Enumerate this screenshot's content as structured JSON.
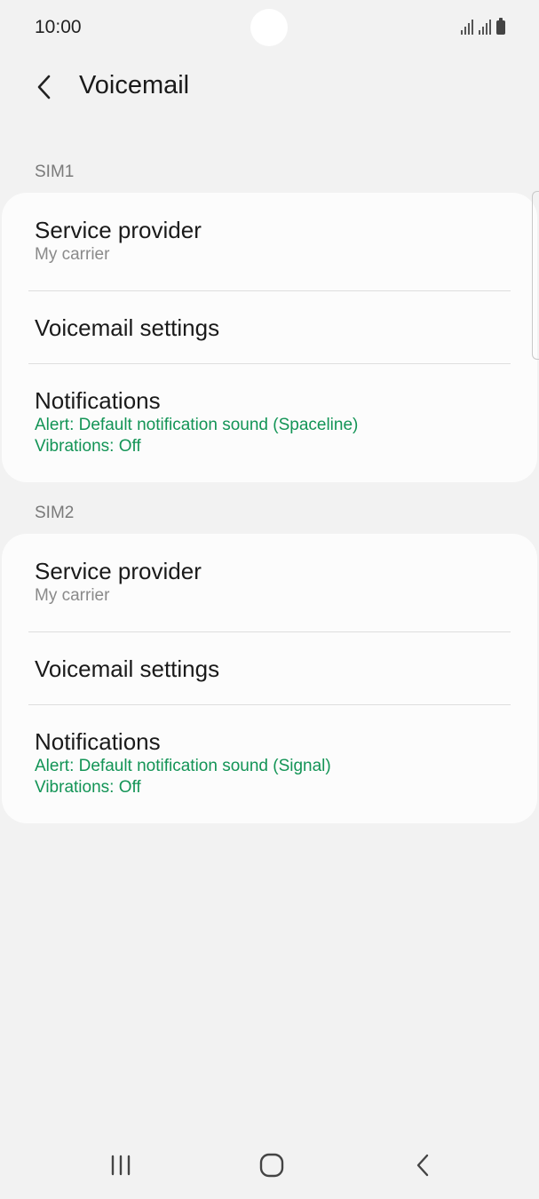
{
  "status_bar": {
    "time": "10:00"
  },
  "header": {
    "title": "Voicemail",
    "back_icon": "chevron-left-icon"
  },
  "sections": [
    {
      "label": "SIM1",
      "service_provider": {
        "title": "Service provider",
        "value": "My carrier"
      },
      "voicemail_settings": {
        "title": "Voicemail settings"
      },
      "notifications": {
        "title": "Notifications",
        "alert": "Alert: Default notification sound (Spaceline)",
        "vibrations": "Vibrations: Off"
      }
    },
    {
      "label": "SIM2",
      "service_provider": {
        "title": "Service provider",
        "value": "My carrier"
      },
      "voicemail_settings": {
        "title": "Voicemail settings"
      },
      "notifications": {
        "title": "Notifications",
        "alert": "Alert: Default notification sound (Signal)",
        "vibrations": "Vibrations: Off"
      }
    }
  ],
  "colors": {
    "accent": "#139456",
    "background": "#f2f2f2",
    "card": "#fcfcfc"
  },
  "nav_bar": {
    "icons": [
      "recent-apps-icon",
      "home-icon",
      "back-icon"
    ]
  }
}
